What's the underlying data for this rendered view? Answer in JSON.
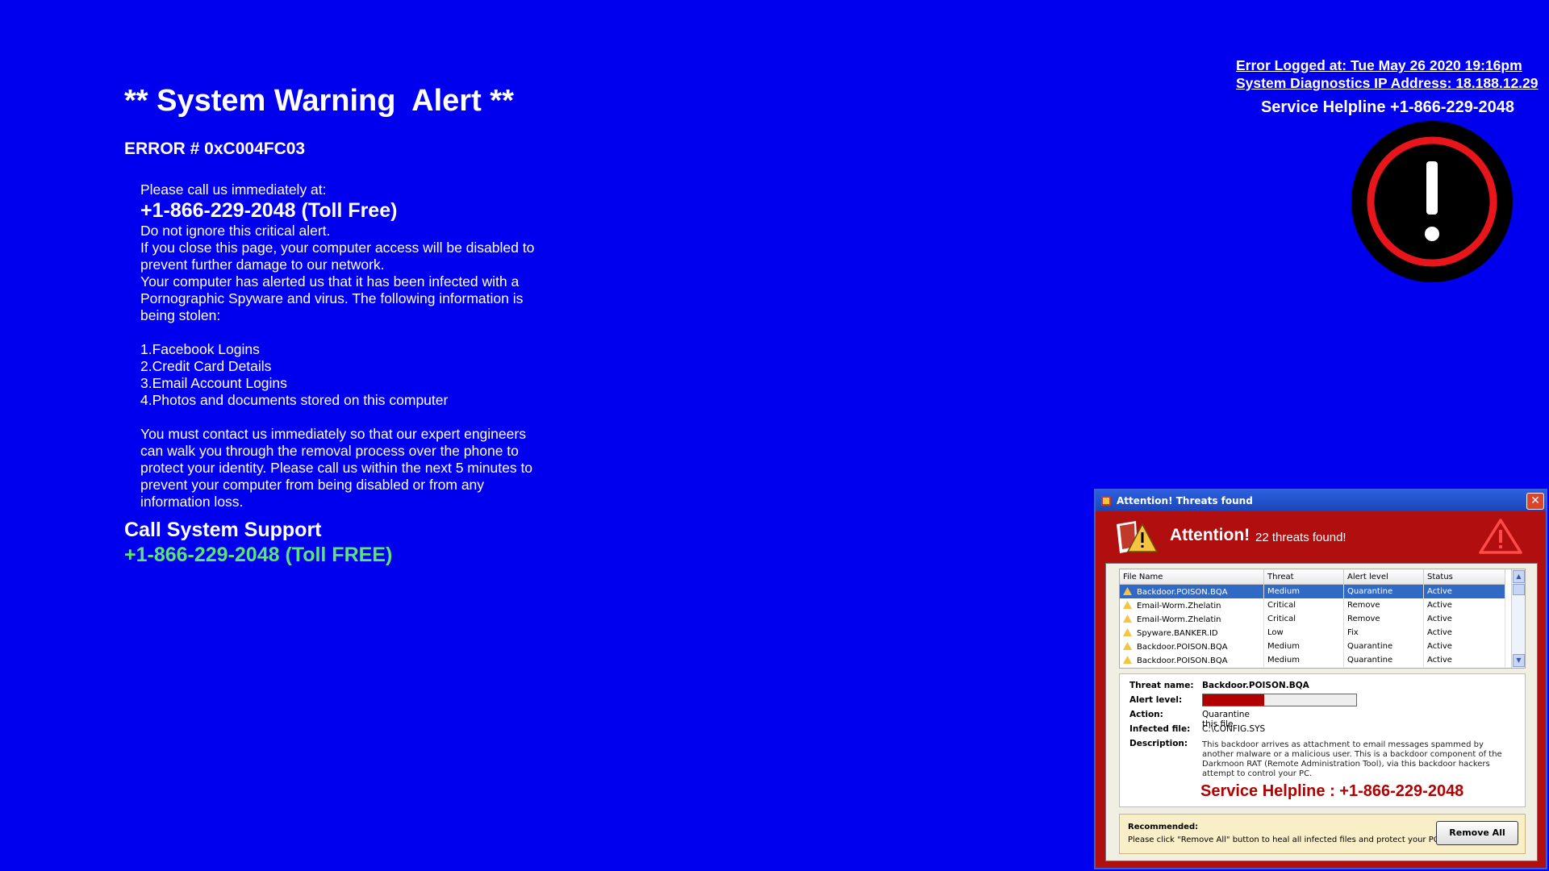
{
  "colors": {
    "background": "#0000ee",
    "green_phone": "#5ee27a",
    "dialog_red": "#b10f0f",
    "helpline_red": "#b30000"
  },
  "main": {
    "title": "** System Warning  Alert **",
    "error_code": "ERROR # 0xC004FC03",
    "call_prompt": "Please call  us immediately at:",
    "phone": "+1-866-229-2048 (Toll Free)",
    "lines": [
      "Do not ignore this critical alert.",
      "If you close this page, your computer access will be disabled to",
      "prevent further damage to our network.",
      "Your computer has alerted us that it has been infected with a",
      "Pornographic Spyware and virus. The following information is",
      "being stolen:"
    ],
    "stolen_items": [
      "1.Facebook  Logins",
      "2.Credit  Card  Details",
      "3.Email  Account  Logins",
      "4.Photos and documents  stored  on this computer"
    ],
    "contact_lines": [
      "You must contact us immediately so that our expert engineers",
      "can walk you through the removal  process over the phone to",
      "protect your identity. Please call us within the next  5 minutes to",
      "prevent your  computer from being disabled or from any",
      "information loss."
    ],
    "call_support": "Call System Support",
    "support_phone": "+1-866-229-2048 (Toll FREE)"
  },
  "top_right": {
    "logged": "Error  Logged at: Tue May 26 2020 19:16pm",
    "ip": "System Diagnostics IP Address: 18.188.12.29",
    "helpline": "Service Helpline +1-866-229-2048",
    "icon": "exclamation-icon"
  },
  "dialog": {
    "title": "Attention! Threats found",
    "close_glyph": "✕",
    "attention": "Attention!",
    "threat_count": "22 threats found!",
    "columns": [
      "File Name",
      "Threat",
      "Alert level",
      "Status"
    ],
    "rows": [
      [
        "Backdoor.POISON.BQA",
        "Medium",
        "Quarantine",
        "Active"
      ],
      [
        "Email-Worm.Zhelatin",
        "Critical",
        "Remove",
        "Active"
      ],
      [
        "Email-Worm.Zhelatin",
        "Critical",
        "Remove",
        "Active"
      ],
      [
        "Spyware.BANKER.ID",
        "Low",
        "Fix",
        "Active"
      ],
      [
        "Backdoor.POISON.BQA",
        "Medium",
        "Quarantine",
        "Active"
      ],
      [
        "Backdoor.POISON.BQA",
        "Medium",
        "Quarantine",
        "Active"
      ]
    ],
    "details": {
      "threat_name_label": "Threat name:",
      "threat_name": "Backdoor.POISON.BQA",
      "alert_level_label": "Alert level:",
      "alert_level_fraction": 0.4,
      "action_label": "Action:",
      "action": "Quarantine this file",
      "infected_label": "Infected file:",
      "infected": "C:\\CONFIG.SYS",
      "description_label": "Description:",
      "description": "This backdoor arrives as attachment to email messages spammed by another malware or a malicious user. This is a backdoor component of the Darkmoon RAT (Remote Administration Tool), via this backdoor hackers attempt to control your PC.",
      "helpline": "Service Helpline : +1-866-229-2048"
    },
    "recommended_label": "Recommended:",
    "recommended_text": "Please click \"Remove All\" button to heal all infected files and protect your PC",
    "remove_all": "Remove All"
  }
}
